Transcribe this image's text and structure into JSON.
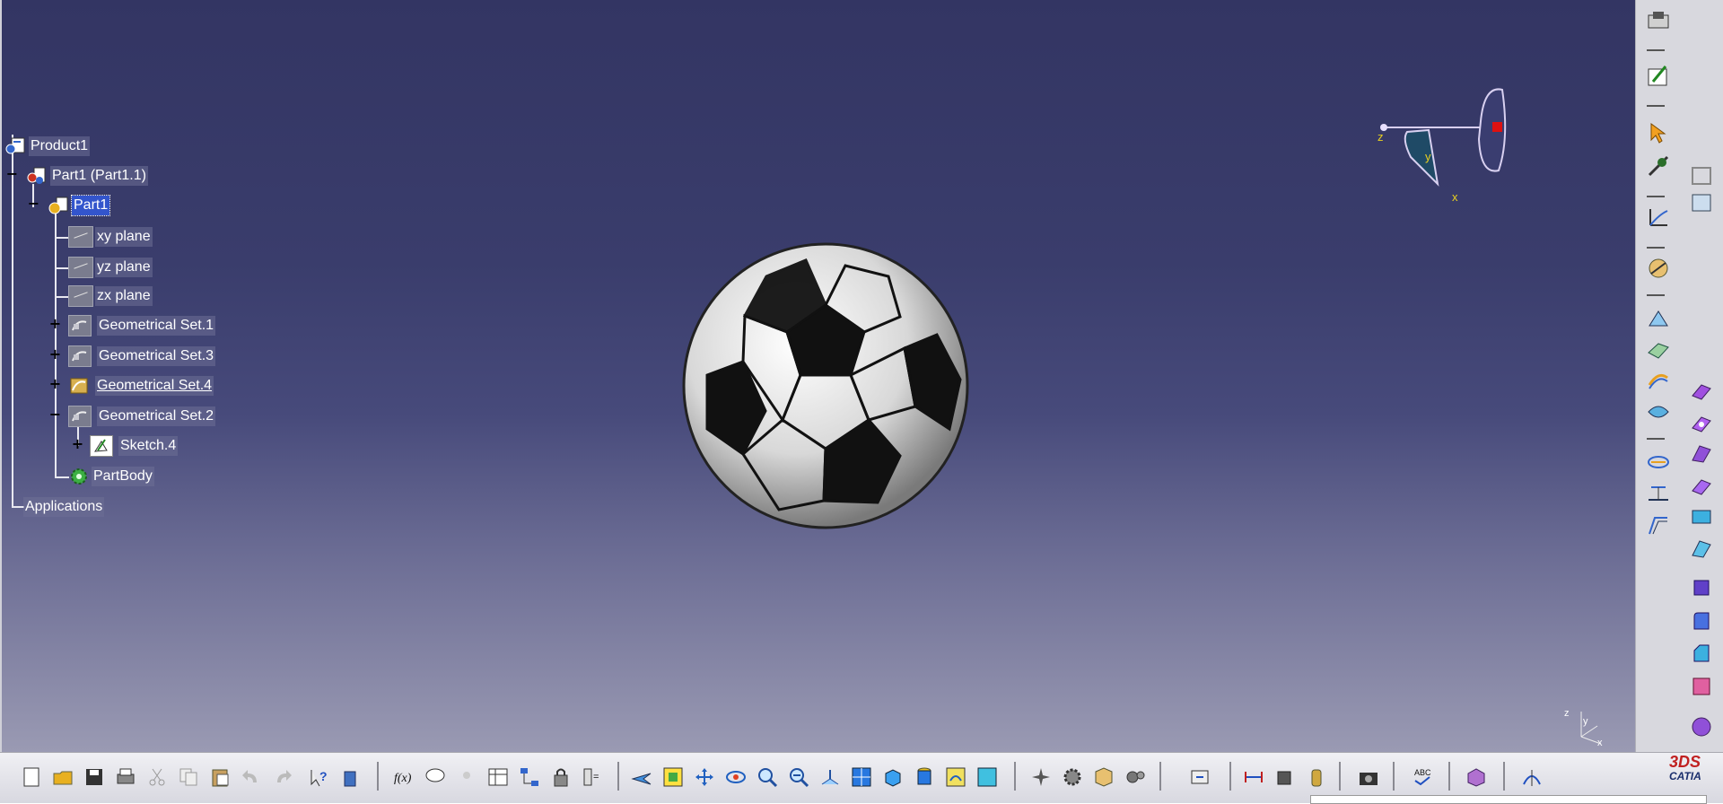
{
  "tree": {
    "product": "Product1",
    "part_instance": "Part1 (Part1.1)",
    "part": "Part1",
    "planes": [
      "xy plane",
      "yz plane",
      "zx plane"
    ],
    "geo_sets": [
      {
        "label": "Geometrical Set.1",
        "expander": "+"
      },
      {
        "label": "Geometrical Set.3",
        "expander": "+"
      },
      {
        "label": "Geometrical Set.4",
        "expander": "+"
      },
      {
        "label": "Geometrical Set.2",
        "expander": "−"
      }
    ],
    "sketch": "Sketch.4",
    "body": "PartBody",
    "applications": "Applications"
  },
  "compass": {
    "x": "x",
    "y": "y",
    "z": "z"
  },
  "axis_mini": {
    "z": "z",
    "y": "y",
    "x": "x"
  },
  "logo": {
    "brand": "CATIA",
    "mark": "3DS"
  },
  "colors": {
    "selected": "#3355cc",
    "compass_red": "#dd1111",
    "compass_y": "#e8d020"
  }
}
